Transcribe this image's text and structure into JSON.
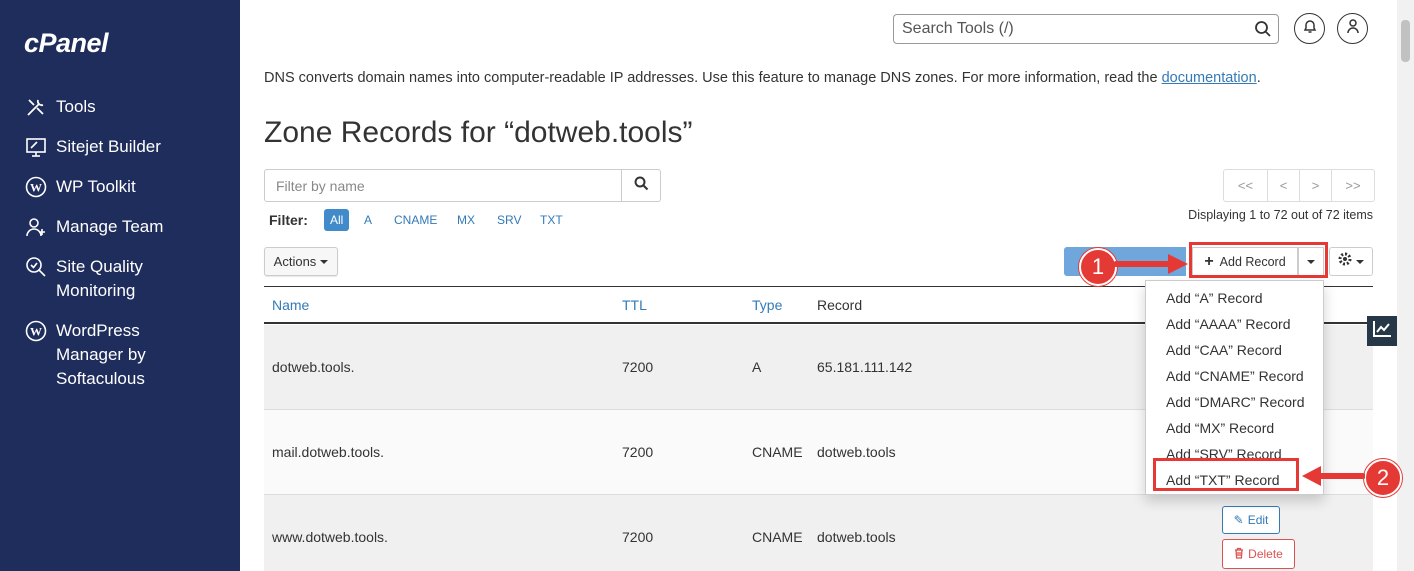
{
  "sidebar": {
    "logo": "cPanel",
    "items": [
      {
        "label": "Tools",
        "icon": "tools-icon"
      },
      {
        "label": "Sitejet Builder",
        "icon": "monitor-icon"
      },
      {
        "label": "WP Toolkit",
        "icon": "wordpress-icon"
      },
      {
        "label": "Manage Team",
        "icon": "user-add-icon"
      },
      {
        "label": "Site Quality\nMonitoring",
        "icon": "magnifier-check-icon"
      },
      {
        "label": "WordPress\nManager by\nSoftaculous",
        "icon": "wordpress-icon"
      }
    ]
  },
  "header": {
    "search_placeholder": "Search Tools (/)"
  },
  "description": {
    "text": "DNS converts domain names into computer-readable IP addresses. Use this feature to manage DNS zones. For more information, read the ",
    "link": "documentation",
    "end": "."
  },
  "page_title": "Zone Records for “dotweb.tools”",
  "filter": {
    "placeholder": "Filter by name",
    "label": "Filter:",
    "chips": [
      "All",
      "A",
      "CNAME",
      "MX",
      "SRV",
      "TXT"
    ]
  },
  "pagination": {
    "first": "<<",
    "prev": "<",
    "next": ">",
    "last": ">>",
    "summary": "Displaying 1 to 72 out of 72 items"
  },
  "toolbar": {
    "actions_label": "Actions",
    "add_record_label": "Add Record"
  },
  "table": {
    "headers": {
      "name": "Name",
      "ttl": "TTL",
      "type": "Type",
      "record": "Record"
    },
    "rows": [
      {
        "name": "dotweb.tools.",
        "ttl": "7200",
        "type": "A",
        "record": "65.181.111.142"
      },
      {
        "name": "mail.dotweb.tools.",
        "ttl": "7200",
        "type": "CNAME",
        "record": "dotweb.tools"
      },
      {
        "name": "www.dotweb.tools.",
        "ttl": "7200",
        "type": "CNAME",
        "record": "dotweb.tools"
      }
    ],
    "edit_label": "Edit",
    "delete_label": "Delete"
  },
  "dropdown": {
    "items": [
      "Add “A” Record",
      "Add “AAAA” Record",
      "Add “CAA” Record",
      "Add “CNAME” Record",
      "Add “DMARC” Record",
      "Add “MX” Record",
      "Add “SRV” Record",
      "Add “TXT” Record"
    ]
  },
  "callouts": [
    "1",
    "2"
  ],
  "colors": {
    "sidebar": "#1f2d5c",
    "link": "#337ab7",
    "highlight": "#e53935",
    "danger": "#d9534f"
  }
}
